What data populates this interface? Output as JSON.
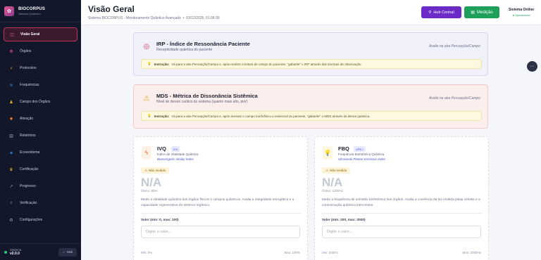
{
  "brand": {
    "name": "BIOCORPUS",
    "subtitle": "Sistema Quântico"
  },
  "sidebar": {
    "items": [
      {
        "label": "Visão Geral",
        "icon": "dashboard-icon",
        "glyph": "◫",
        "color": "#e25a93",
        "active": true
      },
      {
        "label": "Órgãos",
        "icon": "organ-icon",
        "glyph": "❁",
        "color": "#e25a93"
      },
      {
        "label": "Protocolos",
        "icon": "bolt-icon",
        "glyph": "⚡",
        "color": "#f0b429"
      },
      {
        "label": "Frequências",
        "icon": "wave-icon",
        "glyph": "≋",
        "color": "#3b8ee8"
      },
      {
        "label": "Campo dos Órgãos",
        "icon": "field-icon",
        "glyph": "♟",
        "color": "#f0b429"
      },
      {
        "label": "Ativação",
        "icon": "fire-icon",
        "glyph": "✹",
        "color": "#f07a29"
      },
      {
        "label": "Relatórios",
        "icon": "chart-icon",
        "glyph": "▥",
        "color": "#9aa2b8"
      },
      {
        "label": "Ecossistema",
        "icon": "globe-icon",
        "glyph": "◈",
        "color": "#3b8ee8"
      },
      {
        "label": "Certificação",
        "icon": "trophy-icon",
        "glyph": "♛",
        "color": "#f0b429"
      },
      {
        "label": "Progresso",
        "icon": "progress-icon",
        "glyph": "↗",
        "color": "#9aa2b8"
      },
      {
        "label": "Verificação",
        "icon": "search-icon",
        "glyph": "⌕",
        "color": "#9aa2b8"
      },
      {
        "label": "Configurações",
        "icon": "gear-icon",
        "glyph": "⚙",
        "color": "#9aa2b8"
      }
    ],
    "footer": {
      "status": "Sistema",
      "version": "v2.0.0",
      "hub_label": "Hub"
    }
  },
  "header": {
    "title": "Visão Geral",
    "subtitle": "Sistema BIOCORPUS - Monitoramento Quântico Avançado",
    "datetime": "03/12/2025, 01:08:39",
    "hub_button": "Hub Central",
    "measure_button": "Medição",
    "system_label": "Sistema Online",
    "system_status": "● Operacional"
  },
  "irp": {
    "title": "IRP - Índice de Ressonância Paciente",
    "subtitle": "Receptividade quântica do paciente",
    "right": "Avalie na aba Percepção/Campo",
    "instruction_label": "Instrução:",
    "instruction": "Vá para a aba Percepção/Campo e, após realizar a leitura de campo do paciente, \"gabarite\" o IRP através das técnicas de observação."
  },
  "mds": {
    "title": "MDS - Métrica de Dissonância Sistêmica",
    "subtitle": "Nível de desvio caótico do sistema (quanto mais alto, pior)",
    "right": "Avalie na aba Percepção/Campo",
    "instruction_label": "Instrução:",
    "instruction": "Vá para a aba Percepção/Campo e, após acessar o campo morfofísico e essencial do paciente, \"gabarite\" o MDS através da leitura quântica."
  },
  "metrics": [
    {
      "name": "IVQ",
      "badge": "EVI",
      "full": "Índice de Vitalidade Quântica",
      "english": "Bioenergetic Vitality Index",
      "status": "Não medido",
      "value": "N/A",
      "optimal": "Ótimo: 85%",
      "description": "Mede a vitalidade quântica dos órgãos físicos e campos quânticos. Avalia a integridade energética e a capacidade regenerativa do sistema orgânico.",
      "input_label": "Valor (min: 0, max: 100)",
      "placeholder": "Digite o valor...",
      "min_label": "Min: 0%",
      "max_label": "Max: 100%",
      "icon": "lightning-icon"
    },
    {
      "name": "FBQ",
      "badge": "UPE-I",
      "full": "Frequência Biofotônica Quântica",
      "english": "Ultraweak Photon Emission Index",
      "status": "Não medido",
      "value": "N/A",
      "optimal": "Ótimo: 1200Hz",
      "description": "Mede a frequência de emissão biofotônica dos órgãos. Avalia a coerência da luz emitida pelas células e a comunicação quântica intercelular.",
      "input_label": "Valor (min: 200, max: 2000)",
      "placeholder": "Digite o valor...",
      "min_label": "Min: 200Hz",
      "max_label": "Max: 2000Hz",
      "icon": "lightbulb-icon"
    }
  ]
}
